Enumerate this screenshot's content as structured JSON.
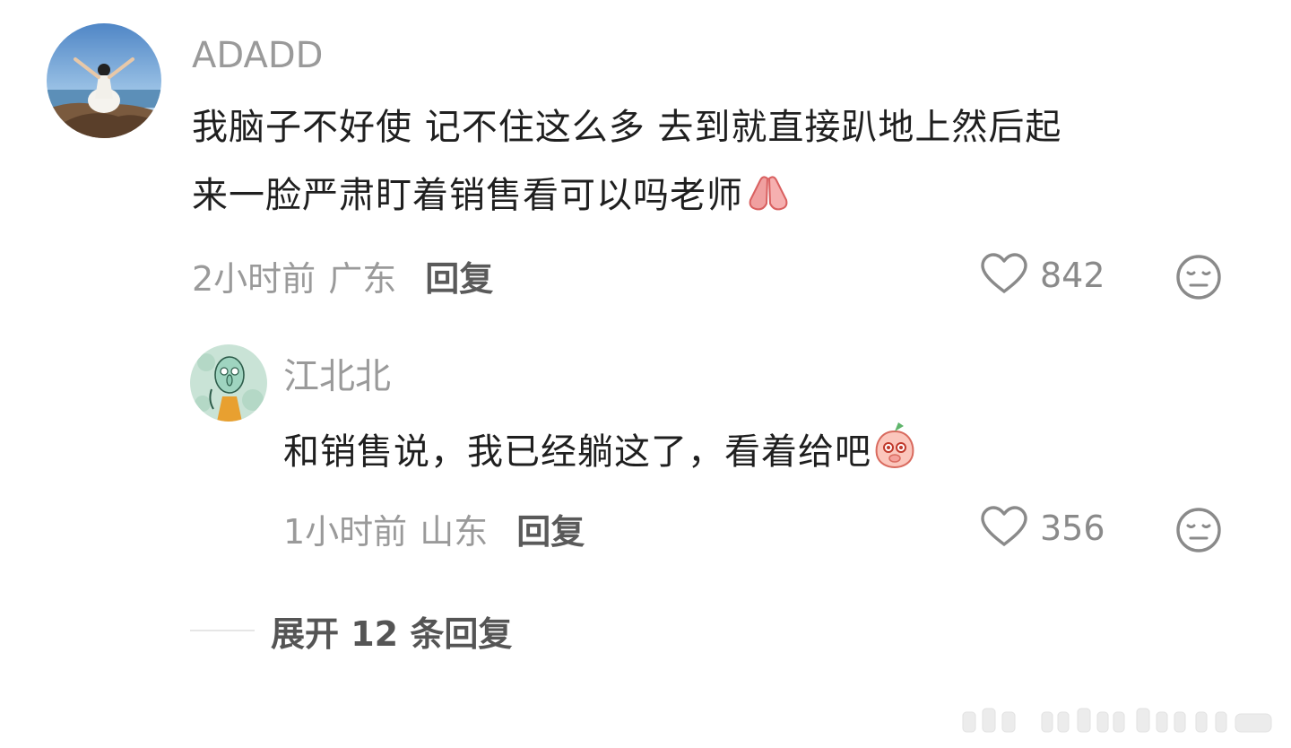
{
  "comment": {
    "username": "ADADD",
    "text_line1": "我脑子不好使 记不住这么多 去到就直接趴地上然后起",
    "text_line2": "来一脸严肃盯着销售看可以吗老师",
    "emoji": "pray-hands-emoji",
    "time": "2小时前",
    "location": "广东",
    "reply_label": "回复",
    "likes": "842"
  },
  "reply": {
    "username": "江北北",
    "text": "和销售说，我已经躺这了，看着给吧",
    "emoji": "peach-shy-emoji",
    "time": "1小时前",
    "location": "山东",
    "reply_label": "回复",
    "likes": "356"
  },
  "expand": {
    "label": "展开 12 条回复"
  },
  "icons": {
    "like": "heart-icon",
    "dislike": "neutral-face-icon"
  },
  "colors": {
    "username": "#9a9a9a",
    "text": "#1f1f1f",
    "meta": "#9a9a9a",
    "reply_link": "#5a5a5a"
  }
}
